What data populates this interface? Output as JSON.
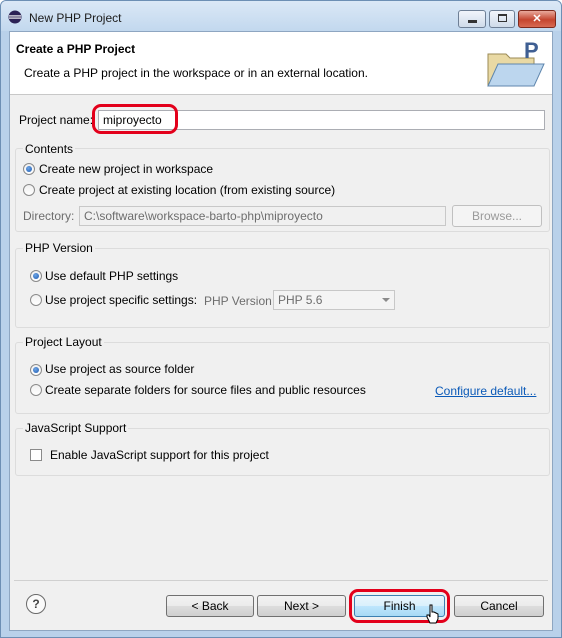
{
  "window": {
    "title": "New PHP Project"
  },
  "banner": {
    "title": "Create a PHP Project",
    "description": "Create a PHP project in the workspace or in an external location."
  },
  "project_name": {
    "label": "Project name:",
    "value": "miproyecto"
  },
  "contents": {
    "title": "Contents",
    "option_new": "Create new project in workspace",
    "option_existing": "Create project at existing location (from existing source)",
    "directory_label": "Directory:",
    "directory_value": "C:\\software\\workspace-barto-php\\miproyecto",
    "browse_label": "Browse..."
  },
  "php_version": {
    "title": "PHP Version",
    "option_default": "Use default PHP settings",
    "option_specific": "Use project specific settings:",
    "version_label": "PHP Version:",
    "version_selected": "PHP 5.6"
  },
  "project_layout": {
    "title": "Project Layout",
    "option_source": "Use project as source folder",
    "option_separate": "Create separate folders for source files and public resources",
    "configure_link": "Configure default..."
  },
  "javascript": {
    "title": "JavaScript Support",
    "enable_label": "Enable JavaScript support for this project"
  },
  "footer": {
    "help_symbol": "?",
    "back_label": "< Back",
    "next_label": "Next >",
    "finish_label": "Finish",
    "cancel_label": "Cancel"
  },
  "icons": {
    "app_icon": "eclipse-icon",
    "banner_icon": "php-folder-icon"
  },
  "colors": {
    "highlight_ring": "#e3001b",
    "link": "#0b5ab8"
  }
}
